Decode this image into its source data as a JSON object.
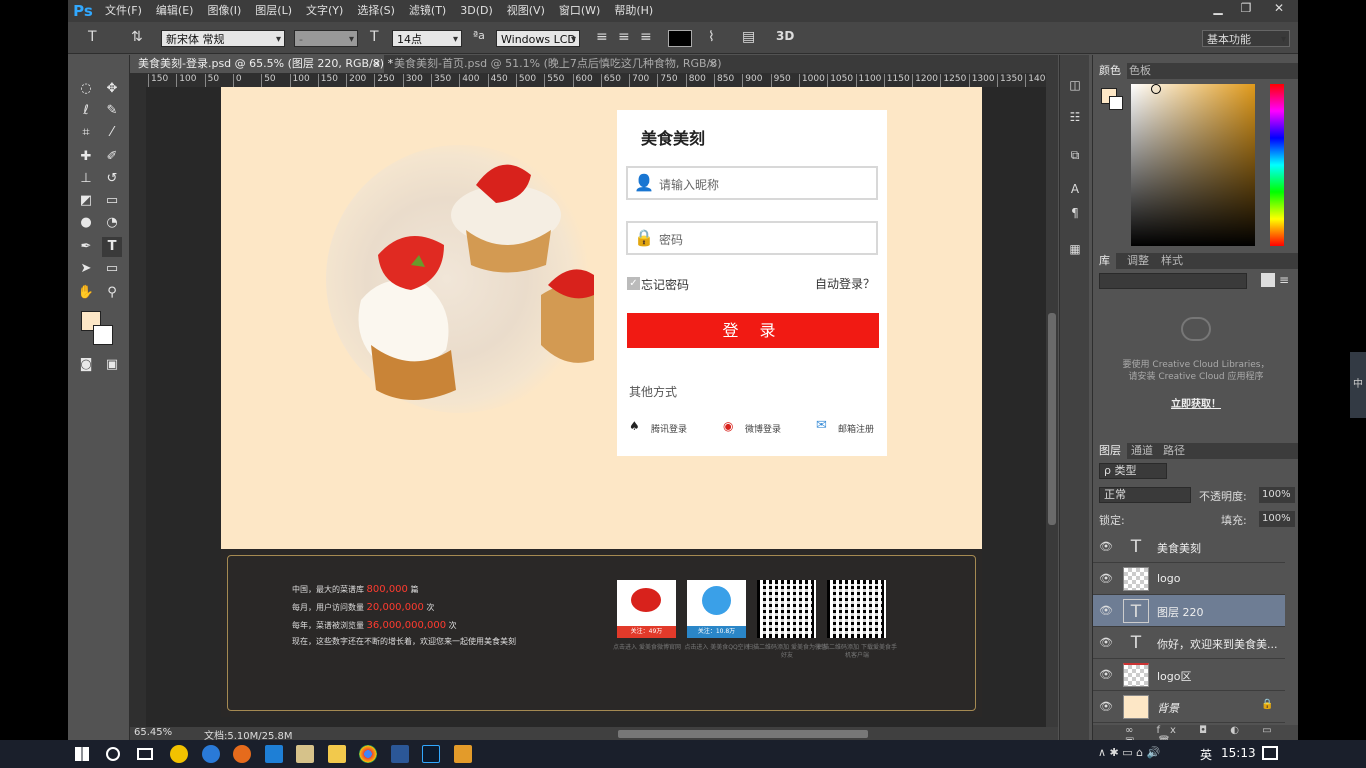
{
  "app": {
    "logo": "Ps"
  },
  "menu": [
    "文件(F)",
    "编辑(E)",
    "图像(I)",
    "图层(L)",
    "文字(Y)",
    "选择(S)",
    "滤镜(T)",
    "3D(D)",
    "视图(V)",
    "窗口(W)",
    "帮助(H)"
  ],
  "window_controls": {
    "minimize": "▁",
    "restore": "❐",
    "close": "✕"
  },
  "options": {
    "tool_glyph": "T",
    "font_family": "新宋体 常规",
    "font_style": "-",
    "font_size": "14点",
    "aa_label": "ªa",
    "aa_mode": "Windows LCD",
    "threeD": "3D",
    "workspace": "基本功能",
    "text_color": "#000000"
  },
  "tabs": [
    {
      "label": "美食美刻-登录.psd @ 65.5% (图层 220, RGB/8) *",
      "close": "×"
    },
    {
      "label": "美食美刻-首页.psd @ 51.1% (晚上7点后慎吃这几种食物, RGB/8)",
      "close": "×"
    }
  ],
  "ruler_ticks": [
    "150",
    "100",
    "50",
    "0",
    "50",
    "100",
    "150",
    "200",
    "250",
    "300",
    "350",
    "400",
    "450",
    "500",
    "550",
    "600",
    "650",
    "700",
    "750",
    "800",
    "850",
    "900",
    "950",
    "1000",
    "1050",
    "1100",
    "1150",
    "1200",
    "1250",
    "1300",
    "1350",
    "1400",
    "14"
  ],
  "artboard": {
    "bg_color": "#fde7c6",
    "login": {
      "title": "美食美刻",
      "username_placeholder": "请输入昵称",
      "password_placeholder": "密码",
      "remember": "忘记密码",
      "auto_login": "自动登录？",
      "button": "登 录",
      "button_color": "#f11a13",
      "other_label": "其他方式",
      "socials": [
        {
          "icon": "qq-icon",
          "label": "腾讯登录"
        },
        {
          "icon": "weibo-icon",
          "label": "微博登录"
        },
        {
          "icon": "mail-icon",
          "label": "邮箱注册"
        }
      ]
    },
    "footer": {
      "stats": [
        {
          "pre": "中国，最大的菜谱库",
          "num": "800,000",
          "post": "篇"
        },
        {
          "pre": "每月，用户访问数量",
          "num": "20,000,000",
          "post": "次"
        },
        {
          "pre": "每年，菜谱被浏览量",
          "num": "36,000,000,000",
          "post": "次"
        },
        {
          "pre": "现在，这些数字还在不断的增长着，欢迎您来一起使用美食美刻",
          "num": "",
          "post": ""
        }
      ],
      "cards": [
        {
          "badge": "关注：49万",
          "caption": "点击进入 爱美食微博官网"
        },
        {
          "badge": "关注：10.8万",
          "caption": "点击进入 美美食QQ空间"
        },
        {
          "badge": "",
          "caption": "扫描二维码添加 爱美食为微信好友"
        },
        {
          "badge": "",
          "caption": "扫描二维码添加 下载爱美食手机客户端"
        }
      ]
    }
  },
  "status": {
    "zoom": "65.45%",
    "doc": "文档:5.10M/25.8M"
  },
  "panels": {
    "color_tabs": [
      "颜色",
      "色板"
    ],
    "library_tabs": [
      "库",
      "调整",
      "样式"
    ],
    "library_msg_1": "要使用 Creative Cloud Libraries，",
    "library_msg_2": "请安装 Creative Cloud 应用程序",
    "library_link": "立即获取！",
    "layers_tabs": [
      "图层",
      "通道",
      "路径"
    ],
    "filter_kind": "ρ 类型",
    "blend_mode": "正常",
    "opacity_label": "不透明度:",
    "opacity": "100%",
    "lock_label": "锁定:",
    "fill_label": "填充:",
    "fill": "100%",
    "fg_color": "#fde7c6",
    "layers": [
      {
        "name": "美食美刻",
        "kind": "text",
        "selected": false
      },
      {
        "name": "logo",
        "kind": "pixel",
        "selected": false
      },
      {
        "name": "图层 220",
        "kind": "text",
        "selected": true
      },
      {
        "name": "你好，欢迎来到美食美...",
        "kind": "text",
        "selected": false
      },
      {
        "name": "logo区",
        "kind": "pixel",
        "selected": false
      },
      {
        "name": "背景",
        "kind": "bg",
        "selected": false
      }
    ]
  },
  "taskbar": {
    "ime": "英",
    "time": "15:13"
  },
  "side_handle": "中"
}
